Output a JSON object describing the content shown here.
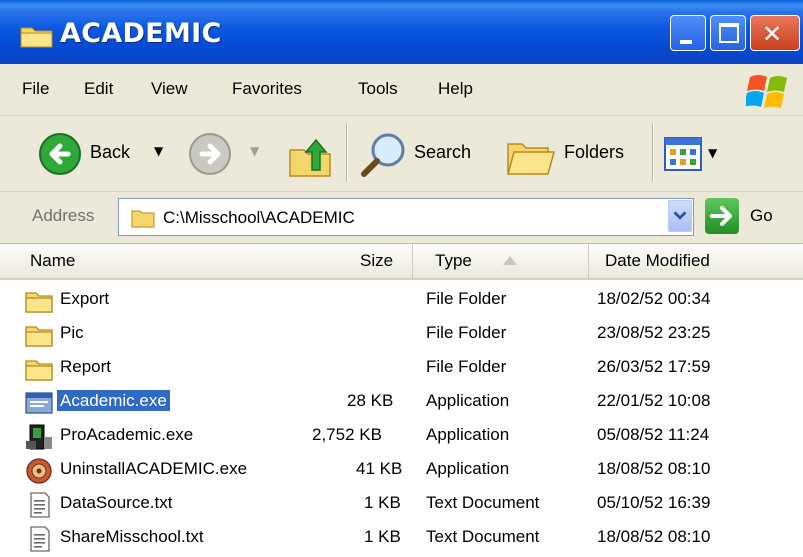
{
  "window": {
    "title": "ACADEMIC",
    "accent": "#0a4fd6"
  },
  "menu": [
    "File",
    "Edit",
    "View",
    "Favorites",
    "Tools",
    "Help"
  ],
  "toolbar": {
    "back_label": "Back",
    "search_label": "Search",
    "folders_label": "Folders"
  },
  "address": {
    "label": "Address",
    "value": "C:\\Misschool\\ACADEMIC",
    "go_label": "Go"
  },
  "columns": {
    "name": "Name",
    "size": "Size",
    "type": "Type",
    "date": "Date Modified"
  },
  "files": [
    {
      "name": "Export",
      "size": "",
      "type": "File Folder",
      "date": "18/02/52 00:34",
      "icon": "folder-icon"
    },
    {
      "name": "Pic",
      "size": "",
      "type": "File Folder",
      "date": "23/08/52 23:25",
      "icon": "folder-icon"
    },
    {
      "name": "Report",
      "size": "",
      "type": "File Folder",
      "date": "26/03/52 17:59",
      "icon": "folder-icon"
    },
    {
      "name": "Academic.exe",
      "size": "28 KB",
      "type": "Application",
      "date": "22/01/52 10:08",
      "icon": "application-icon",
      "selected": true
    },
    {
      "name": "ProAcademic.exe",
      "size": "2,752 KB",
      "type": "Application",
      "date": "05/08/52 11:24",
      "icon": "pro-application-icon"
    },
    {
      "name": "UninstallACADEMIC.exe",
      "size": "41 KB",
      "type": "Application",
      "date": "18/08/52 08:10",
      "icon": "uninstall-icon"
    },
    {
      "name": "DataSource.txt",
      "size": "1 KB",
      "type": "Text Document",
      "date": "05/10/52 16:39",
      "icon": "text-document-icon"
    },
    {
      "name": "ShareMisschool.txt",
      "size": "1 KB",
      "type": "Text Document",
      "date": "18/08/52 08:10",
      "icon": "text-document-icon"
    }
  ],
  "colors": {
    "chrome": "#ece9d8",
    "selection": "#316ac5"
  }
}
